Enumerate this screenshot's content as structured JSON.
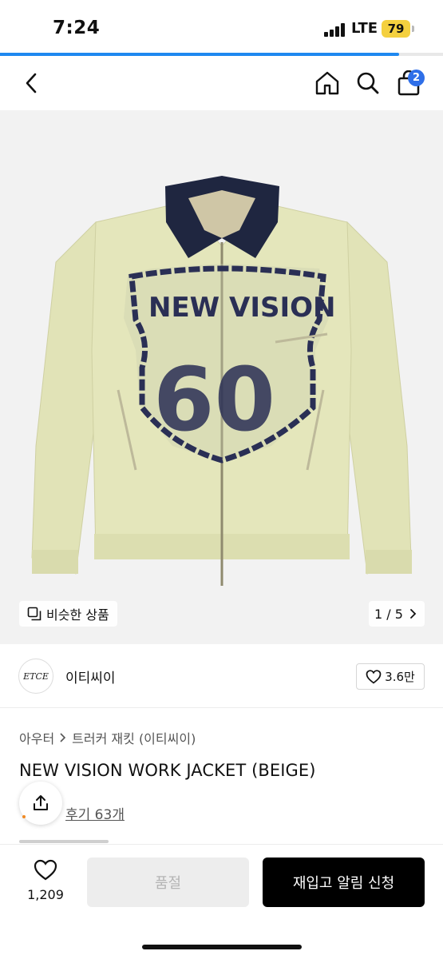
{
  "status_bar": {
    "time": "7:24",
    "network": "LTE",
    "battery": "79"
  },
  "page_load_progress": 0.9,
  "nav": {
    "back_icon": "chevron-left-icon",
    "home_icon": "home-icon",
    "search_icon": "search-icon",
    "cart_icon": "shopping-bag-icon",
    "cart_count": "2"
  },
  "hero": {
    "image_description_icon": "jacket-photo",
    "similar_products_label": "비슷한 상품",
    "image_counter": "1 / 5"
  },
  "brand": {
    "logo_text": "ETCE",
    "name": "이티씨이",
    "likes": "3.6만"
  },
  "product": {
    "breadcrumb": [
      "아우터",
      "트러커 재킷 (이티씨이)"
    ],
    "title": "NEW VISION WORK JACKET (BEIGE)",
    "review_label": "후기 63개"
  },
  "bottom_bar": {
    "wish_count": "1,209",
    "soldout_label": "품절",
    "restock_label": "재입고 알림 신청"
  },
  "colors": {
    "accent_blue": "#1e88f0",
    "badge_blue": "#2f6fe8",
    "battery_yellow": "#f4d03f",
    "jacket_body": "#e3e5ba",
    "collar_navy": "#1f2640"
  }
}
